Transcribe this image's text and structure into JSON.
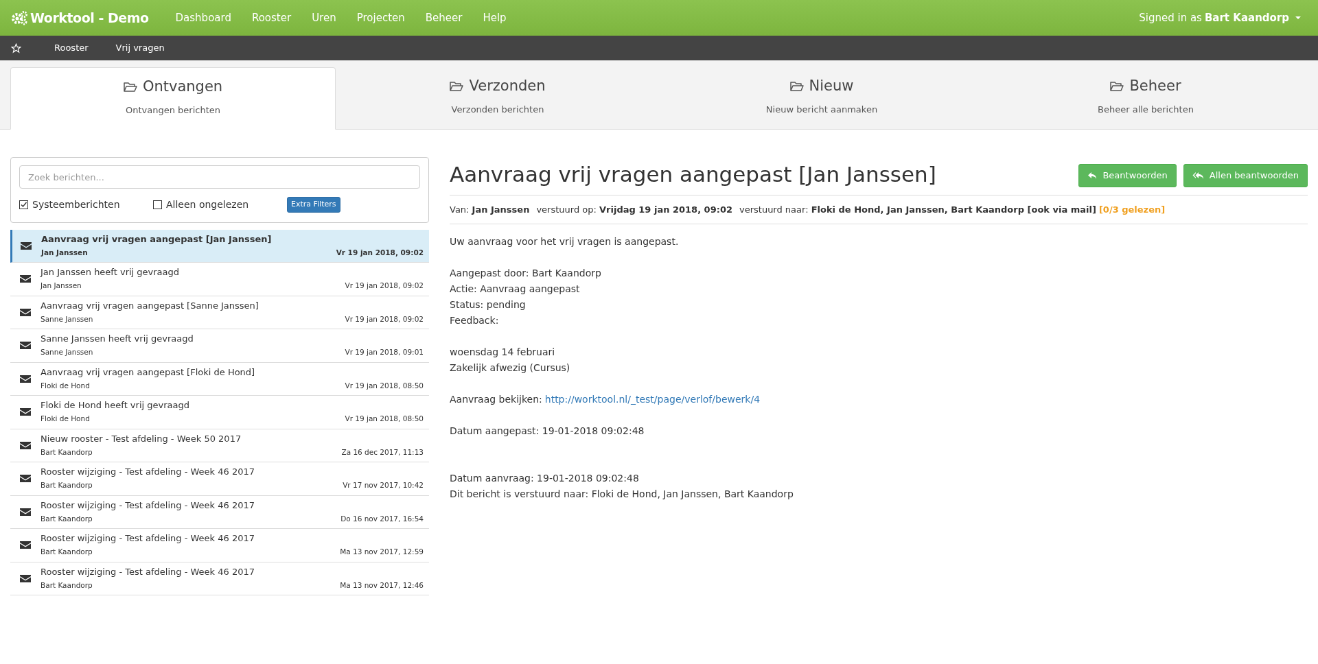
{
  "navbar": {
    "brand": "Worktool - Demo",
    "menu": [
      "Dashboard",
      "Rooster",
      "Uren",
      "Projecten",
      "Beheer",
      "Help"
    ],
    "signed_in_label": "Signed in as",
    "user": "Bart Kaandorp"
  },
  "breadcrumb": [
    "Rooster",
    "Vrij vragen"
  ],
  "tabs": [
    {
      "title": "Ontvangen",
      "subtitle": "Ontvangen berichten",
      "selected": true
    },
    {
      "title": "Verzonden",
      "subtitle": "Verzonden berichten",
      "selected": false
    },
    {
      "title": "Nieuw",
      "subtitle": "Nieuw bericht aanmaken",
      "selected": false
    },
    {
      "title": "Beheer",
      "subtitle": "Beheer alle berichten",
      "selected": false
    }
  ],
  "filters": {
    "search_placeholder": "Zoek berichten...",
    "checkboxes": [
      {
        "label": "Systeemberichten",
        "checked": true
      },
      {
        "label": "Alleen ongelezen",
        "checked": false
      }
    ],
    "extra_button": "Extra Filters"
  },
  "messages": [
    {
      "subject": "Aanvraag vrij vragen aangepast [Jan Janssen]",
      "sender": "Jan Janssen",
      "date": "Vr 19 jan 2018, 09:02",
      "selected": true
    },
    {
      "subject": "Jan Janssen heeft vrij gevraagd",
      "sender": "Jan Janssen",
      "date": "Vr 19 jan 2018, 09:02",
      "selected": false
    },
    {
      "subject": "Aanvraag vrij vragen aangepast [Sanne Janssen]",
      "sender": "Sanne Janssen",
      "date": "Vr 19 jan 2018, 09:02",
      "selected": false
    },
    {
      "subject": "Sanne Janssen heeft vrij gevraagd",
      "sender": "Sanne Janssen",
      "date": "Vr 19 jan 2018, 09:01",
      "selected": false
    },
    {
      "subject": "Aanvraag vrij vragen aangepast [Floki de Hond]",
      "sender": "Floki de Hond",
      "date": "Vr 19 jan 2018, 08:50",
      "selected": false
    },
    {
      "subject": "Floki de Hond heeft vrij gevraagd",
      "sender": "Floki de Hond",
      "date": "Vr 19 jan 2018, 08:50",
      "selected": false
    },
    {
      "subject": "Nieuw rooster - Test afdeling - Week 50 2017",
      "sender": "Bart Kaandorp",
      "date": "Za 16 dec 2017, 11:13",
      "selected": false
    },
    {
      "subject": "Rooster wijziging - Test afdeling - Week 46 2017",
      "sender": "Bart Kaandorp",
      "date": "Vr 17 nov 2017, 10:42",
      "selected": false
    },
    {
      "subject": "Rooster wijziging - Test afdeling - Week 46 2017",
      "sender": "Bart Kaandorp",
      "date": "Do 16 nov 2017, 16:54",
      "selected": false
    },
    {
      "subject": "Rooster wijziging - Test afdeling - Week 46 2017",
      "sender": "Bart Kaandorp",
      "date": "Ma 13 nov 2017, 12:59",
      "selected": false
    },
    {
      "subject": "Rooster wijziging - Test afdeling - Week 46 2017",
      "sender": "Bart Kaandorp",
      "date": "Ma 13 nov 2017, 12:46",
      "selected": false
    }
  ],
  "detail": {
    "title": "Aanvraag vrij vragen aangepast [Jan Janssen]",
    "buttons": [
      "Beantwoorden",
      "Allen beantwoorden"
    ],
    "meta": [
      {
        "label": "Van:",
        "value": "Jan Janssen"
      },
      {
        "label": "verstuurd op:",
        "value": "Vrijdag 19 jan 2018, 09:02"
      },
      {
        "label": "verstuurd naar:",
        "value": "Floki de Hond, Jan Janssen, Bart Kaandorp [ook via mail]"
      }
    ],
    "read_status": "[0/3 gelezen]",
    "body": [
      {
        "kind": "paragraph",
        "lines": [
          "Uw aanvraag voor het vrij vragen is aangepast."
        ]
      },
      {
        "kind": "paragraph",
        "lines": [
          "Aangepast door: Bart Kaandorp",
          "Actie: Aanvraag aangepast",
          "Status: pending",
          "Feedback:"
        ]
      },
      {
        "kind": "paragraph",
        "lines": [
          "woensdag 14 februari",
          "Zakelijk afwezig (Cursus)"
        ]
      },
      {
        "kind": "link_paragraph",
        "text": "Aanvraag bekijken:",
        "link": "http://worktool.nl/_test/page/verlof/bewerk/4"
      },
      {
        "kind": "paragraph",
        "lines": [
          "Datum aangepast: 19-01-2018 09:02:48"
        ]
      },
      {
        "kind": "wide_paragraph",
        "lines": [
          "Datum aanvraag: 19-01-2018 09:02:48",
          "Dit bericht is verstuurd naar: Floki de Hond, Jan Janssen, Bart Kaandorp"
        ]
      }
    ]
  }
}
